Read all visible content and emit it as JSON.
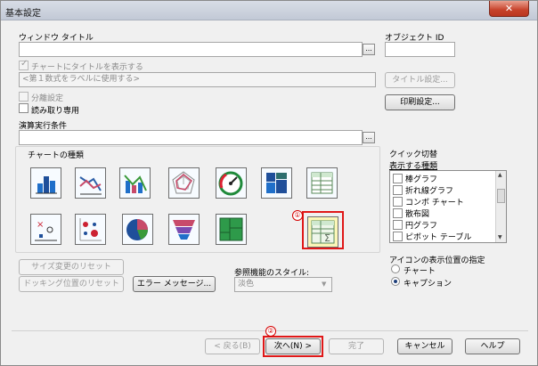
{
  "window": {
    "title": "基本設定",
    "close_label": "✕"
  },
  "window_title_field": {
    "label": "ウィンドウ タイトル",
    "value": "",
    "ellipsis": "..."
  },
  "object_id": {
    "label": "オブジェクト ID",
    "value": ""
  },
  "show_title": {
    "label": "チャートにタイトルを表示する",
    "checked": true
  },
  "title_placeholder": "<第１数式をラベルに使用する>",
  "title_settings_button": "タイトル設定...",
  "print_settings_button": "印刷設定...",
  "detach": {
    "label": "分離設定",
    "checked": false
  },
  "read_only": {
    "label": "読み取り専用",
    "checked": false
  },
  "calc_condition": {
    "label": "演算実行条件",
    "value": "",
    "ellipsis": "..."
  },
  "chart_types": {
    "label": "チャートの種類",
    "icons": [
      {
        "name": "bar-chart-icon"
      },
      {
        "name": "line-chart-icon"
      },
      {
        "name": "combo-chart-icon"
      },
      {
        "name": "radar-chart-icon"
      },
      {
        "name": "gauge-chart-icon"
      },
      {
        "name": "mekko-chart-icon"
      },
      {
        "name": "grid-table-icon"
      },
      {
        "name": "scatter-chart-icon"
      },
      {
        "name": "grid-chart-icon"
      },
      {
        "name": "pie-chart-icon"
      },
      {
        "name": "funnel-chart-icon"
      },
      {
        "name": "block-chart-icon"
      },
      {
        "name": "straight-table-icon"
      }
    ],
    "selected_marker": "①"
  },
  "quick_change": {
    "label": "クイック切替",
    "list_label": "表示する種類",
    "items": [
      {
        "label": "棒グラフ"
      },
      {
        "label": "折れ線グラフ"
      },
      {
        "label": "コンボ チャート"
      },
      {
        "label": "散布図"
      },
      {
        "label": "円グラフ"
      },
      {
        "label": "ピボット テーブル"
      }
    ],
    "scroll_up": "▲",
    "scroll_down": "▼"
  },
  "icon_position": {
    "label": "アイコンの表示位置の指定",
    "options": [
      {
        "label": "チャート",
        "selected": false
      },
      {
        "label": "キャプション",
        "selected": true
      }
    ]
  },
  "reset_size_button": "サイズ変更のリセット",
  "reset_docking_button": "ドッキング位置のリセット",
  "error_message_button": "エラー メッセージ...",
  "reference_style": {
    "label": "参照機能のスタイル:",
    "value": "淡色"
  },
  "footer": {
    "back_button": "< 戻る(B)",
    "next_button": "次へ(N) >",
    "next_marker": "②",
    "finish_button": "完了",
    "cancel_button": "キャンセル",
    "help_button": "ヘルプ"
  },
  "colors": {
    "highlight": "#e01818",
    "selected_icon_bg": "#fbf6b8"
  }
}
